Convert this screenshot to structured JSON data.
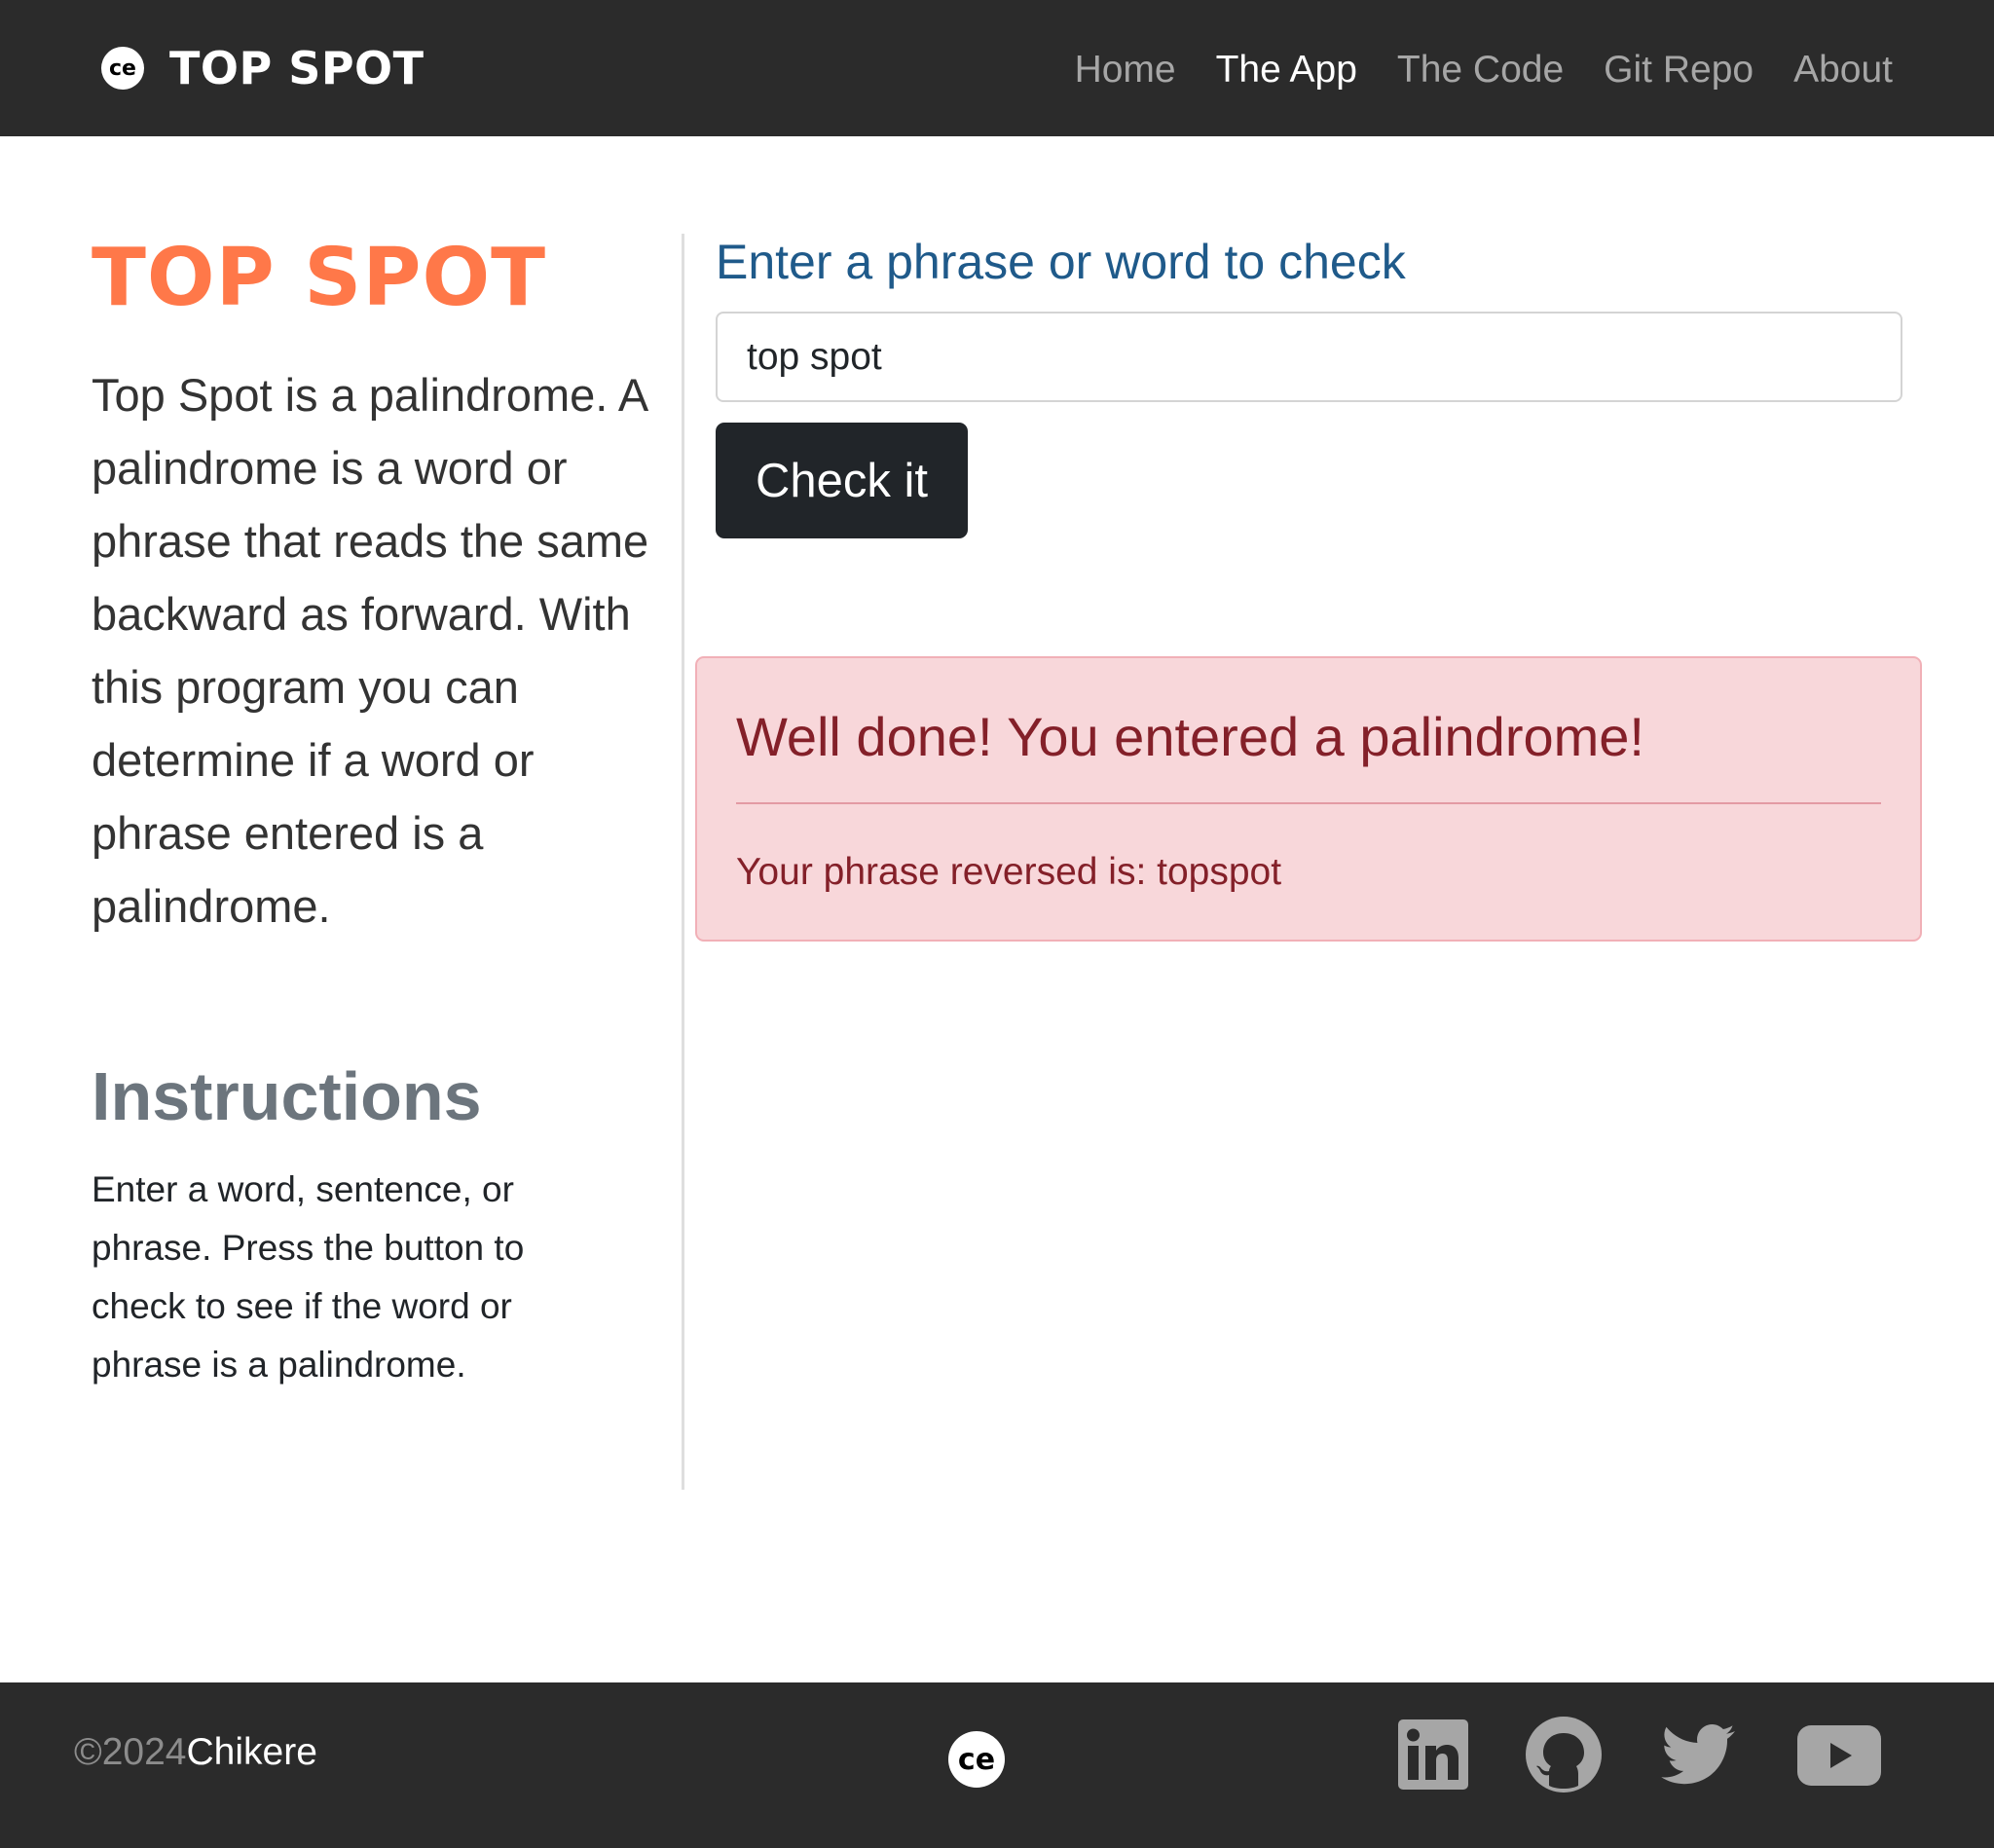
{
  "navbar": {
    "logo": "ce",
    "brand": "TOP SPOT",
    "links": [
      {
        "label": "Home",
        "active": false
      },
      {
        "label": "The App",
        "active": true
      },
      {
        "label": "The Code",
        "active": false
      },
      {
        "label": "Git Repo",
        "active": false
      },
      {
        "label": "About",
        "active": false
      }
    ]
  },
  "intro": {
    "title": "TOP SPOT",
    "description": "Top Spot is a palindrome. A palindrome is a word or phrase that reads the same backward as forward. With this program you can determine if a word or phrase entered is a palindrome.",
    "instructions_title": "Instructions",
    "instructions_text": "Enter a word, sentence, or phrase. Press the button to check to see if the word or phrase is a palindrome."
  },
  "form": {
    "label": "Enter a phrase or word to check",
    "input_value": "top spot",
    "button_label": "Check it"
  },
  "alert": {
    "heading": "Well done! You entered a palindrome!",
    "message": "Your phrase reversed is: topspot"
  },
  "footer": {
    "copyright_year": "©2024",
    "copyright_name": "Chikere",
    "logo": "ce",
    "social_icons": [
      "linkedin-icon",
      "github-icon",
      "twitter-icon",
      "youtube-icon"
    ]
  },
  "colors": {
    "navbar_bg": "#2b2b2b",
    "accent_orange": "#ff7849",
    "label_blue": "#1f5a8a",
    "alert_bg": "#f8d7da",
    "alert_text": "#842029",
    "button_bg": "#212529",
    "icon_gray": "#a6a6a6"
  }
}
